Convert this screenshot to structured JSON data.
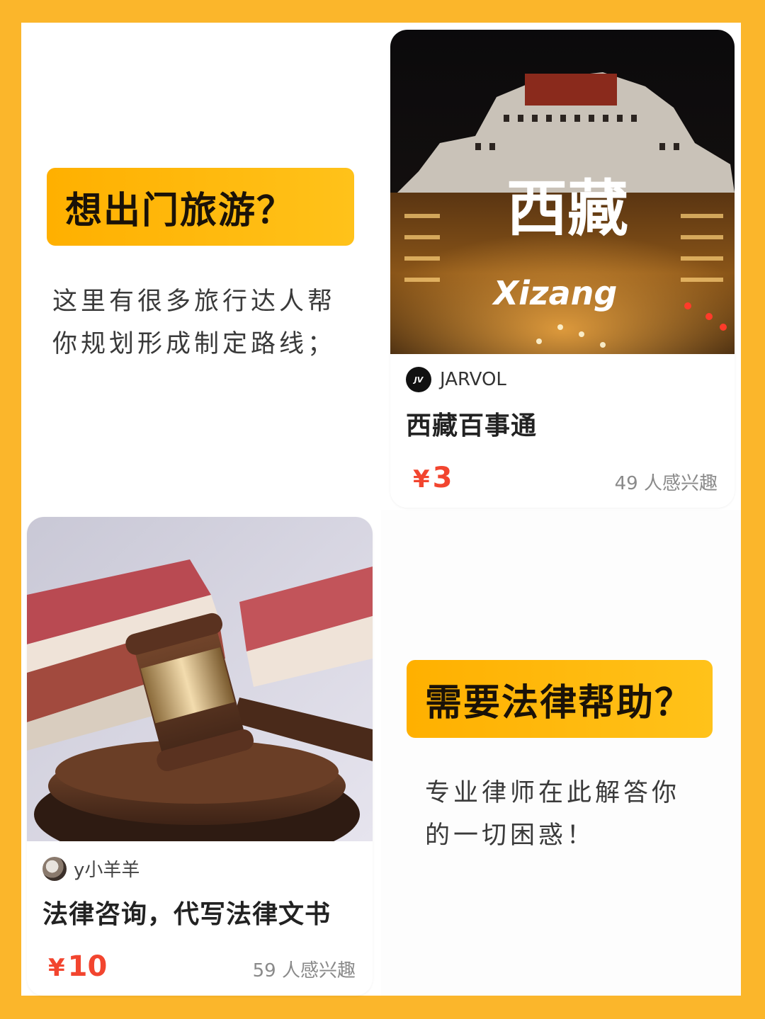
{
  "travel": {
    "tag": "想出门旅游？",
    "desc_line1": "这里有很多旅行达人帮",
    "desc_line2": "你规划形成制定路线；",
    "card": {
      "image_text_cn": "西藏",
      "image_text_en": "Xizang",
      "author_avatar": "JV",
      "author": "JARVOL",
      "title": "西藏百事通",
      "currency": "¥",
      "price": "3",
      "interest": "49 人感兴趣"
    }
  },
  "law": {
    "tag": "需要法律帮助？",
    "desc_line1": "专业律师在此解答你",
    "desc_line2": "的一切困惑！",
    "card": {
      "author": "y小羊羊",
      "title": "法律咨询，代写法律文书",
      "currency": "¥",
      "price": "10",
      "interest": "59 人感兴趣"
    }
  },
  "colors": {
    "background": "#fbb62b",
    "tag": "#ffb000",
    "price": "#f2452f"
  }
}
